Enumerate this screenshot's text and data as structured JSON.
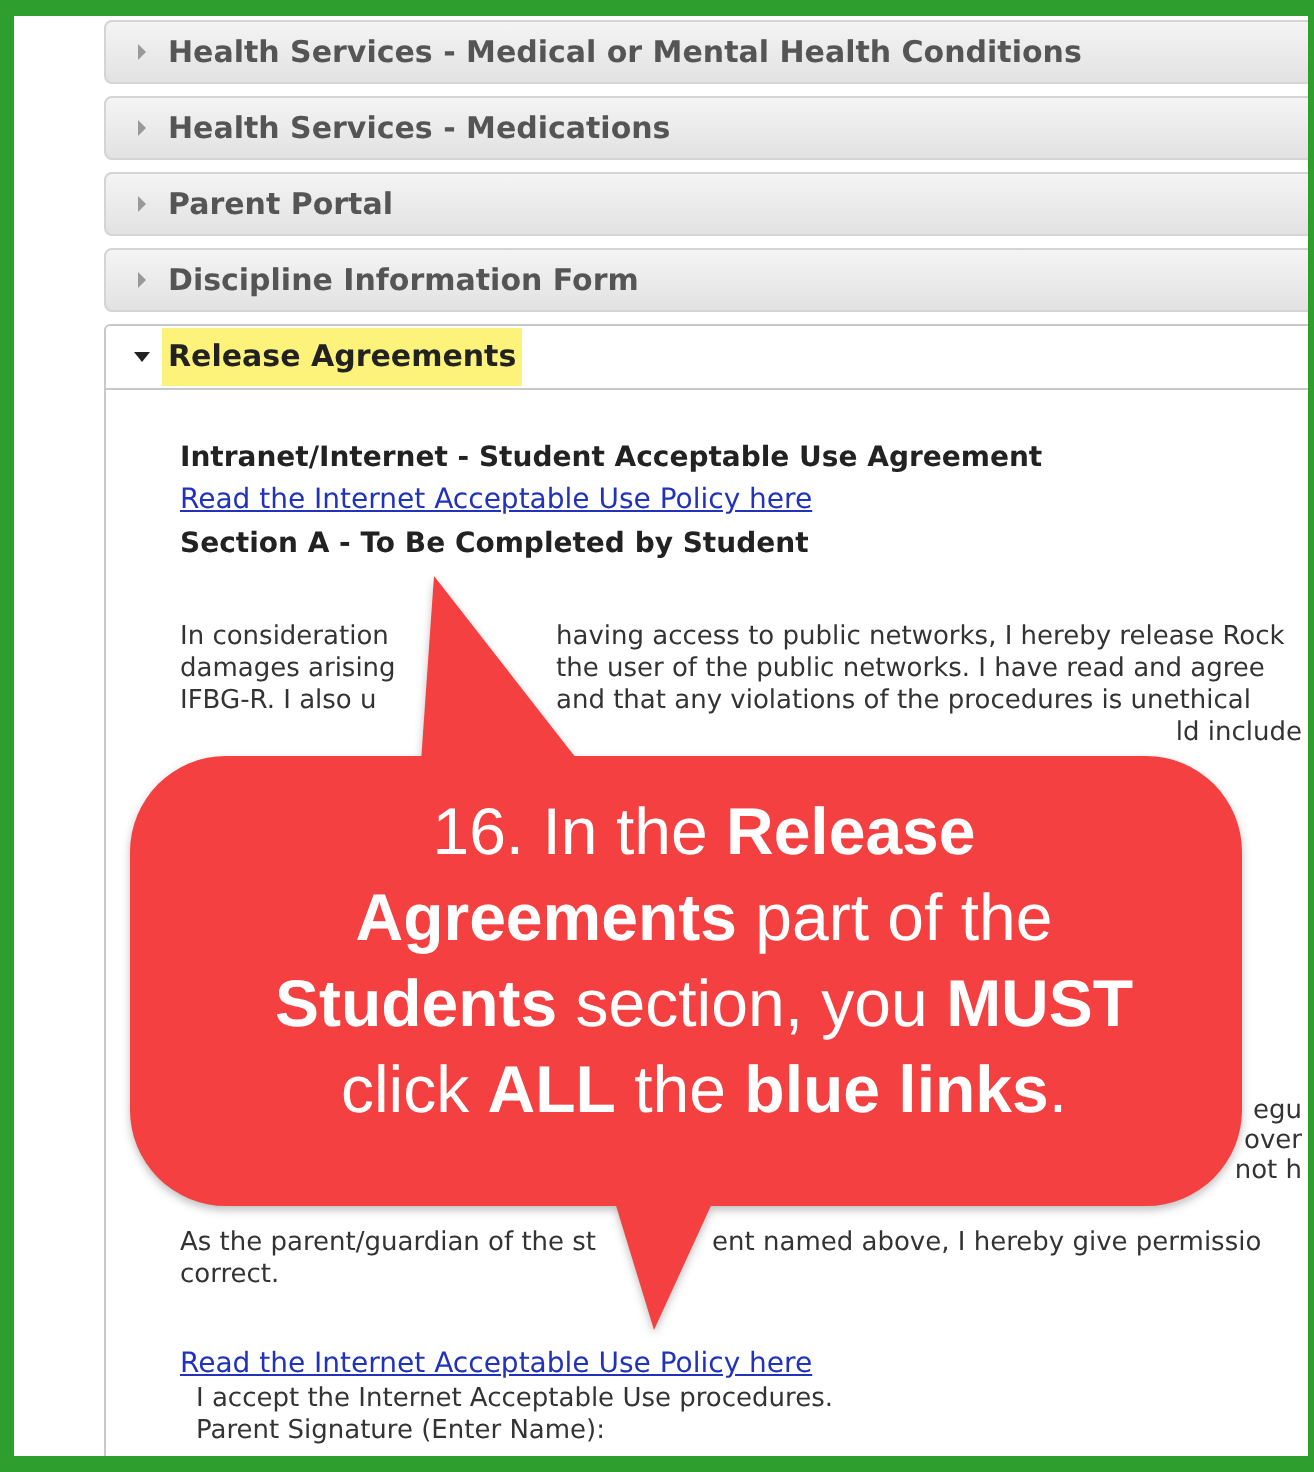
{
  "accordion": [
    {
      "title": "Health Services - Medical or Mental Health Conditions",
      "expanded": false,
      "highlighted": false
    },
    {
      "title": "Health Services - Medications",
      "expanded": false,
      "highlighted": false
    },
    {
      "title": "Parent Portal",
      "expanded": false,
      "highlighted": false
    },
    {
      "title": "Discipline Information Form",
      "expanded": false,
      "highlighted": false
    },
    {
      "title": "Release Agreements",
      "expanded": true,
      "highlighted": true
    }
  ],
  "release_agreements": {
    "heading": "Intranet/Internet - Student Acceptable Use Agreement",
    "policy_link": "Read the Internet Acceptable Use Policy here",
    "section_heading": "Section A - To Be Completed by Student",
    "paragraph_lines": [
      {
        "left": "In consideration",
        "right": "having access to public networks, I hereby release Rock"
      },
      {
        "left": "damages arising",
        "right": "the user of the public networks. I have read and agree"
      },
      {
        "left": "IFBG-R. I also u",
        "right": "and that any violations of the procedures is unethical"
      },
      {
        "right": "ld include"
      }
    ],
    "covered_line_ends": [
      "egu",
      "over",
      "not h"
    ],
    "parent_lines": [
      [
        "As the parent/guardian of the st",
        "ent named above, I hereby give permissio"
      ],
      [
        "correct."
      ]
    ],
    "policy_link_2": "Read the Internet Acceptable Use Policy here",
    "accept_text": "I accept the Internet Acceptable Use procedures.",
    "signature_label": "Parent Signature (Enter Name):"
  },
  "callout": {
    "text": "16. In the **Release**\n**Agreements** part of the\n**Students** section, you **MUST**\nclick **ALL** the **blue links**."
  }
}
